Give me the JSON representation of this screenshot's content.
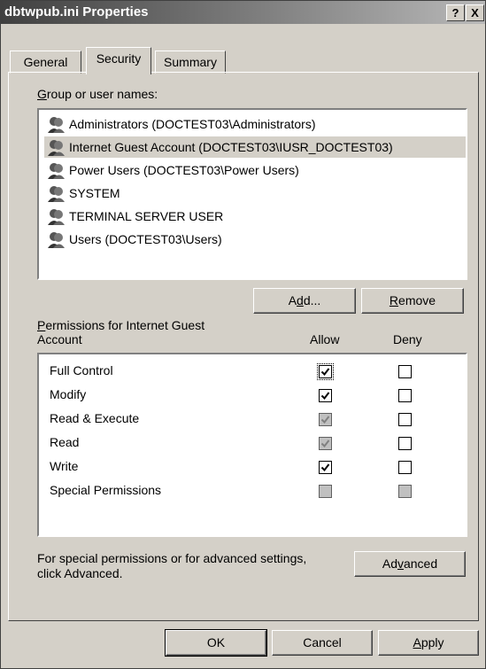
{
  "window": {
    "title": "dbtwpub.ini Properties",
    "help_label": "?",
    "close_label": "X"
  },
  "tabs": [
    {
      "label": "General",
      "active": false
    },
    {
      "label": "Security",
      "active": true
    },
    {
      "label": "Summary",
      "active": false
    }
  ],
  "group_section": {
    "label": "Group or user names:",
    "users": [
      {
        "name": "Administrators (DOCTEST03\\Administrators)",
        "selected": false
      },
      {
        "name": "Internet Guest Account (DOCTEST03\\IUSR_DOCTEST03)",
        "selected": true
      },
      {
        "name": "Power Users (DOCTEST03\\Power Users)",
        "selected": false
      },
      {
        "name": "SYSTEM",
        "selected": false
      },
      {
        "name": "TERMINAL SERVER USER",
        "selected": false
      },
      {
        "name": "Users (DOCTEST03\\Users)",
        "selected": false
      }
    ],
    "add_label": "Add...",
    "remove_label": "Remove"
  },
  "permissions_section": {
    "label_line1": "Permissions for Internet Guest",
    "label_line2": "Account",
    "allow_header": "Allow",
    "deny_header": "Deny",
    "rows": [
      {
        "name": "Full Control",
        "allow": "checked",
        "deny": "unchecked"
      },
      {
        "name": "Modify",
        "allow": "checked",
        "deny": "unchecked"
      },
      {
        "name": "Read & Execute",
        "allow": "checked-grey",
        "deny": "unchecked"
      },
      {
        "name": "Read",
        "allow": "checked-grey",
        "deny": "unchecked"
      },
      {
        "name": "Write",
        "allow": "checked",
        "deny": "unchecked"
      },
      {
        "name": "Special Permissions",
        "allow": "disabled",
        "deny": "disabled"
      }
    ]
  },
  "advanced_section": {
    "text_line1": "For special permissions or for advanced settings,",
    "text_line2": "click Advanced.",
    "advanced_label": "Advanced"
  },
  "footer": {
    "ok_label": "OK",
    "cancel_label": "Cancel",
    "apply_label": "Apply"
  }
}
